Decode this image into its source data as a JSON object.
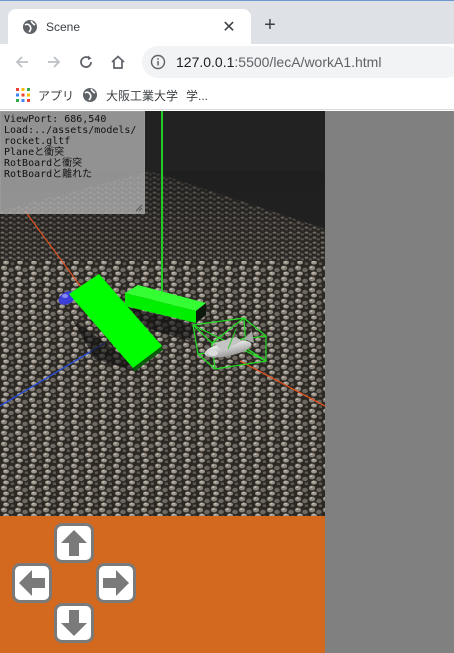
{
  "browser": {
    "tab": {
      "title": "Scene",
      "close_glyph": "✕"
    },
    "new_tab_glyph": "+",
    "address": {
      "host": "127.0.0.1",
      "path": ":5500/lecA/workA1.html"
    },
    "bookmarks": [
      {
        "label": "アプリ",
        "icon": "apps-grid-icon"
      },
      {
        "label": "大阪工業大学",
        "icon": "globe-icon"
      },
      {
        "label": "学...",
        "icon": ""
      }
    ]
  },
  "page": {
    "log_lines": [
      "ViewPort: 686,540",
      "Load:../assets/models/",
      "rocket.gltf",
      "Planeと衝突",
      "RotBoardと衝突",
      "RotBoardと離れた"
    ],
    "controls": {
      "up": "up-arrow-button",
      "left": "left-arrow-button",
      "right": "right-arrow-button",
      "down": "down-arrow-button",
      "panel_color": "#d2691e"
    },
    "scene_colors": {
      "floor": "#3a3631",
      "board": "#00ff00",
      "wireframe": "#22dd22",
      "axis_x": "#e0501e",
      "axis_y": "#22cc22",
      "axis_z": "#2a4fd6",
      "background": "#808080"
    }
  }
}
